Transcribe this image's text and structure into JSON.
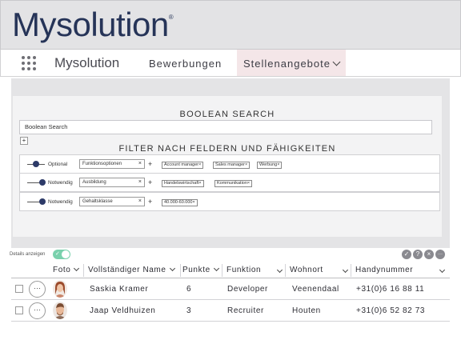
{
  "brand": {
    "logo_text": "Mysolution",
    "logo_mark": "®"
  },
  "nav": {
    "app_title": "Mysolution",
    "items": [
      {
        "label": "Bewerbungen",
        "active": false
      },
      {
        "label": "Stellenangebote",
        "active": true
      }
    ]
  },
  "search": {
    "title": "BOOLEAN SEARCH",
    "input_value": "Boolean Search",
    "add_symbol": "+"
  },
  "filters": {
    "title": "FILTER NACH FELDERN UND FÄHIGKEITEN",
    "rows": [
      {
        "level": "Optional",
        "level_value": 0.75,
        "field": "Funktionsoptionen",
        "chips": [
          "Account manager",
          "Sales manager",
          "Werbung"
        ]
      },
      {
        "level": "Notwendig",
        "level_value": 1.0,
        "field": "Ausbildung",
        "chips": [
          "Handelswirtschaft",
          "Kommunikation"
        ]
      },
      {
        "level": "Notwendig",
        "level_value": 1.0,
        "field": "Gehaltsklasse",
        "chips": [
          "40.000-60.000"
        ]
      }
    ],
    "remove_symbol": "×",
    "plus_symbol": "+"
  },
  "details": {
    "label": "Details anzeigen",
    "enabled": true,
    "accent": "#7ad1ad"
  },
  "actions": [
    {
      "icon": "check-icon",
      "glyph": "✓"
    },
    {
      "icon": "help-icon",
      "glyph": "?"
    },
    {
      "icon": "close-icon",
      "glyph": "×"
    },
    {
      "icon": "more-icon",
      "glyph": "···"
    }
  ],
  "table": {
    "columns": [
      {
        "label": "Foto"
      },
      {
        "label": "Vollständiger Name"
      },
      {
        "label": "Punkte"
      },
      {
        "label": "Funktion"
      },
      {
        "label": "Wohnort"
      },
      {
        "label": "Handynummer"
      }
    ],
    "rows": [
      {
        "name": "Saskia Kramer",
        "score": "6",
        "function": "Developer",
        "city": "Veenendaal",
        "phone": "+31(0)6 16 88 11"
      },
      {
        "name": "Jaap Veldhuizen",
        "score": "3",
        "function": "Recruiter",
        "city": "Houten",
        "phone": "+31(0)6 52 82 73"
      }
    ],
    "row_menu_glyph": "···"
  },
  "colors": {
    "brand": "#263458",
    "slider": "#2d3a68",
    "active_tab_bg": "#f4e6e8"
  }
}
